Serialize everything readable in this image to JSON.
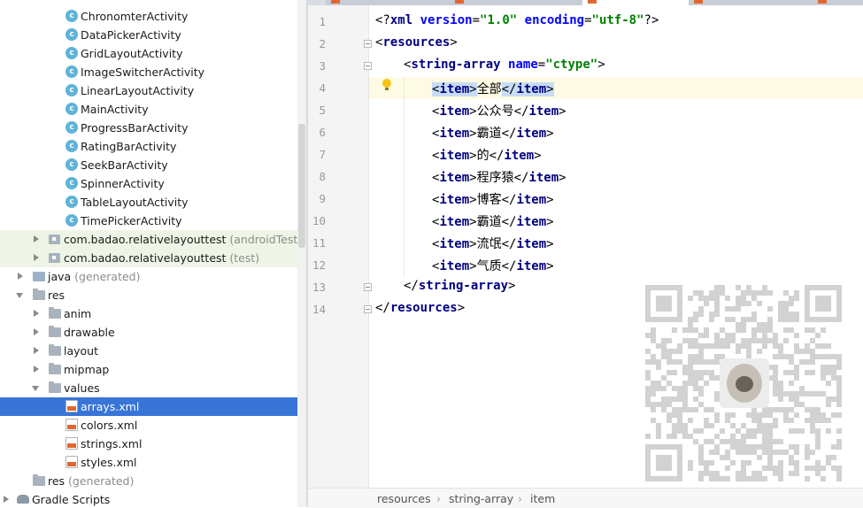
{
  "tree": {
    "items": [
      {
        "label": "ChronomterActivity",
        "icon": "class-icon"
      },
      {
        "label": "DataPickerActivity",
        "icon": "class-icon"
      },
      {
        "label": "GridLayoutActivity",
        "icon": "class-icon"
      },
      {
        "label": "ImageSwitcherActivity",
        "icon": "class-icon"
      },
      {
        "label": "LinearLayoutActivity",
        "icon": "class-icon"
      },
      {
        "label": "MainActivity",
        "icon": "class-icon"
      },
      {
        "label": "ProgressBarActivity",
        "icon": "class-icon"
      },
      {
        "label": "RatingBarActivity",
        "icon": "class-icon"
      },
      {
        "label": "SeekBarActivity",
        "icon": "class-icon"
      },
      {
        "label": "SpinnerActivity",
        "icon": "class-icon"
      },
      {
        "label": "TableLayoutActivity",
        "icon": "class-icon"
      },
      {
        "label": "TimePickerActivity",
        "icon": "class-icon"
      },
      {
        "label": "com.badao.relativelayouttest",
        "suffix": "(androidTest)",
        "icon": "package-icon"
      },
      {
        "label": "com.badao.relativelayouttest",
        "suffix": "(test)",
        "icon": "package-icon"
      },
      {
        "label": "java",
        "suffix": "(generated)",
        "icon": "java-folder-icon"
      },
      {
        "label": "res",
        "icon": "folder-icon"
      },
      {
        "label": "anim",
        "icon": "folder-icon"
      },
      {
        "label": "drawable",
        "icon": "folder-icon"
      },
      {
        "label": "layout",
        "icon": "folder-icon"
      },
      {
        "label": "mipmap",
        "icon": "folder-icon"
      },
      {
        "label": "values",
        "icon": "folder-icon"
      },
      {
        "label": "arrays.xml",
        "icon": "xml-file-icon",
        "selected": true
      },
      {
        "label": "colors.xml",
        "icon": "xml-file-icon"
      },
      {
        "label": "strings.xml",
        "icon": "xml-file-icon"
      },
      {
        "label": "styles.xml",
        "icon": "xml-file-icon"
      },
      {
        "label": "res",
        "suffix": "(generated)",
        "icon": "folder-icon"
      },
      {
        "label": "Gradle Scripts",
        "icon": "gradle-icon"
      }
    ]
  },
  "editor": {
    "line_numbers": [
      "1",
      "2",
      "3",
      "4",
      "5",
      "6",
      "7",
      "8",
      "9",
      "10",
      "11",
      "12",
      "13",
      "14"
    ],
    "xml_decl": {
      "open": "<?",
      "name": "xml",
      "attr1": "version",
      "val1": "\"1.0\"",
      "attr2": "encoding",
      "val2": "\"utf-8\"",
      "close": "?>"
    },
    "resources_tag": "resources",
    "string_array_tag": "string-array",
    "name_attr": "name",
    "name_value": "\"ctype\"",
    "item_tag": "item",
    "items": [
      "全部",
      "公众号",
      "霸道",
      "的",
      "程序猿",
      "博客",
      "霸道",
      "流氓",
      "气质"
    ]
  },
  "breadcrumb": [
    "resources",
    "string-array",
    "item"
  ],
  "colors": {
    "selection": "#3875d7",
    "tag": "#000080",
    "attr": "#0000ff",
    "value": "#008000"
  }
}
